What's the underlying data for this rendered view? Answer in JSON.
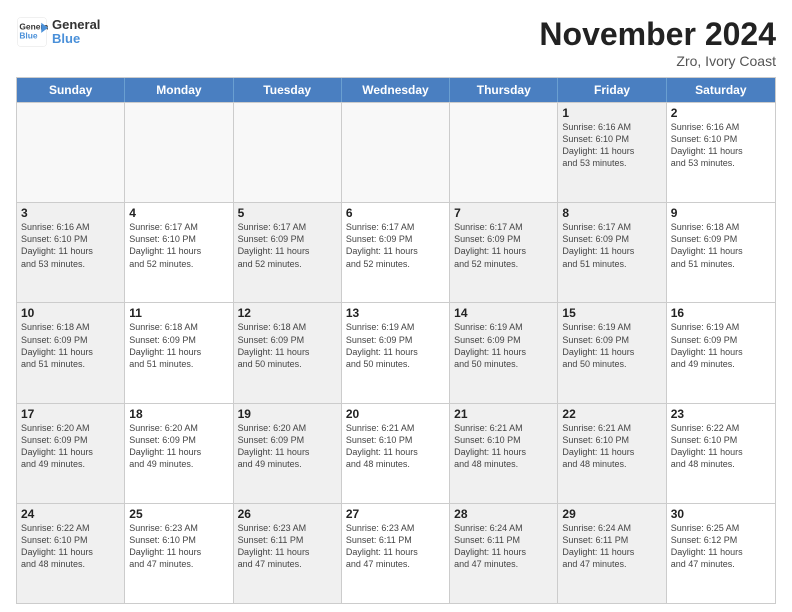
{
  "logo": {
    "line1": "General",
    "line2": "Blue"
  },
  "title": "November 2024",
  "location": "Zro, Ivory Coast",
  "header_days": [
    "Sunday",
    "Monday",
    "Tuesday",
    "Wednesday",
    "Thursday",
    "Friday",
    "Saturday"
  ],
  "rows": [
    [
      {
        "day": "",
        "info": "",
        "empty": true
      },
      {
        "day": "",
        "info": "",
        "empty": true
      },
      {
        "day": "",
        "info": "",
        "empty": true
      },
      {
        "day": "",
        "info": "",
        "empty": true
      },
      {
        "day": "",
        "info": "",
        "empty": true
      },
      {
        "day": "1",
        "info": "Sunrise: 6:16 AM\nSunset: 6:10 PM\nDaylight: 11 hours\nand 53 minutes.",
        "shaded": true
      },
      {
        "day": "2",
        "info": "Sunrise: 6:16 AM\nSunset: 6:10 PM\nDaylight: 11 hours\nand 53 minutes."
      }
    ],
    [
      {
        "day": "3",
        "info": "Sunrise: 6:16 AM\nSunset: 6:10 PM\nDaylight: 11 hours\nand 53 minutes.",
        "shaded": true
      },
      {
        "day": "4",
        "info": "Sunrise: 6:17 AM\nSunset: 6:10 PM\nDaylight: 11 hours\nand 52 minutes."
      },
      {
        "day": "5",
        "info": "Sunrise: 6:17 AM\nSunset: 6:09 PM\nDaylight: 11 hours\nand 52 minutes.",
        "shaded": true
      },
      {
        "day": "6",
        "info": "Sunrise: 6:17 AM\nSunset: 6:09 PM\nDaylight: 11 hours\nand 52 minutes."
      },
      {
        "day": "7",
        "info": "Sunrise: 6:17 AM\nSunset: 6:09 PM\nDaylight: 11 hours\nand 52 minutes.",
        "shaded": true
      },
      {
        "day": "8",
        "info": "Sunrise: 6:17 AM\nSunset: 6:09 PM\nDaylight: 11 hours\nand 51 minutes.",
        "shaded": true
      },
      {
        "day": "9",
        "info": "Sunrise: 6:18 AM\nSunset: 6:09 PM\nDaylight: 11 hours\nand 51 minutes."
      }
    ],
    [
      {
        "day": "10",
        "info": "Sunrise: 6:18 AM\nSunset: 6:09 PM\nDaylight: 11 hours\nand 51 minutes.",
        "shaded": true
      },
      {
        "day": "11",
        "info": "Sunrise: 6:18 AM\nSunset: 6:09 PM\nDaylight: 11 hours\nand 51 minutes."
      },
      {
        "day": "12",
        "info": "Sunrise: 6:18 AM\nSunset: 6:09 PM\nDaylight: 11 hours\nand 50 minutes.",
        "shaded": true
      },
      {
        "day": "13",
        "info": "Sunrise: 6:19 AM\nSunset: 6:09 PM\nDaylight: 11 hours\nand 50 minutes."
      },
      {
        "day": "14",
        "info": "Sunrise: 6:19 AM\nSunset: 6:09 PM\nDaylight: 11 hours\nand 50 minutes.",
        "shaded": true
      },
      {
        "day": "15",
        "info": "Sunrise: 6:19 AM\nSunset: 6:09 PM\nDaylight: 11 hours\nand 50 minutes.",
        "shaded": true
      },
      {
        "day": "16",
        "info": "Sunrise: 6:19 AM\nSunset: 6:09 PM\nDaylight: 11 hours\nand 49 minutes."
      }
    ],
    [
      {
        "day": "17",
        "info": "Sunrise: 6:20 AM\nSunset: 6:09 PM\nDaylight: 11 hours\nand 49 minutes.",
        "shaded": true
      },
      {
        "day": "18",
        "info": "Sunrise: 6:20 AM\nSunset: 6:09 PM\nDaylight: 11 hours\nand 49 minutes."
      },
      {
        "day": "19",
        "info": "Sunrise: 6:20 AM\nSunset: 6:09 PM\nDaylight: 11 hours\nand 49 minutes.",
        "shaded": true
      },
      {
        "day": "20",
        "info": "Sunrise: 6:21 AM\nSunset: 6:10 PM\nDaylight: 11 hours\nand 48 minutes."
      },
      {
        "day": "21",
        "info": "Sunrise: 6:21 AM\nSunset: 6:10 PM\nDaylight: 11 hours\nand 48 minutes.",
        "shaded": true
      },
      {
        "day": "22",
        "info": "Sunrise: 6:21 AM\nSunset: 6:10 PM\nDaylight: 11 hours\nand 48 minutes.",
        "shaded": true
      },
      {
        "day": "23",
        "info": "Sunrise: 6:22 AM\nSunset: 6:10 PM\nDaylight: 11 hours\nand 48 minutes."
      }
    ],
    [
      {
        "day": "24",
        "info": "Sunrise: 6:22 AM\nSunset: 6:10 PM\nDaylight: 11 hours\nand 48 minutes.",
        "shaded": true
      },
      {
        "day": "25",
        "info": "Sunrise: 6:23 AM\nSunset: 6:10 PM\nDaylight: 11 hours\nand 47 minutes."
      },
      {
        "day": "26",
        "info": "Sunrise: 6:23 AM\nSunset: 6:11 PM\nDaylight: 11 hours\nand 47 minutes.",
        "shaded": true
      },
      {
        "day": "27",
        "info": "Sunrise: 6:23 AM\nSunset: 6:11 PM\nDaylight: 11 hours\nand 47 minutes."
      },
      {
        "day": "28",
        "info": "Sunrise: 6:24 AM\nSunset: 6:11 PM\nDaylight: 11 hours\nand 47 minutes.",
        "shaded": true
      },
      {
        "day": "29",
        "info": "Sunrise: 6:24 AM\nSunset: 6:11 PM\nDaylight: 11 hours\nand 47 minutes.",
        "shaded": true
      },
      {
        "day": "30",
        "info": "Sunrise: 6:25 AM\nSunset: 6:12 PM\nDaylight: 11 hours\nand 47 minutes."
      }
    ]
  ]
}
